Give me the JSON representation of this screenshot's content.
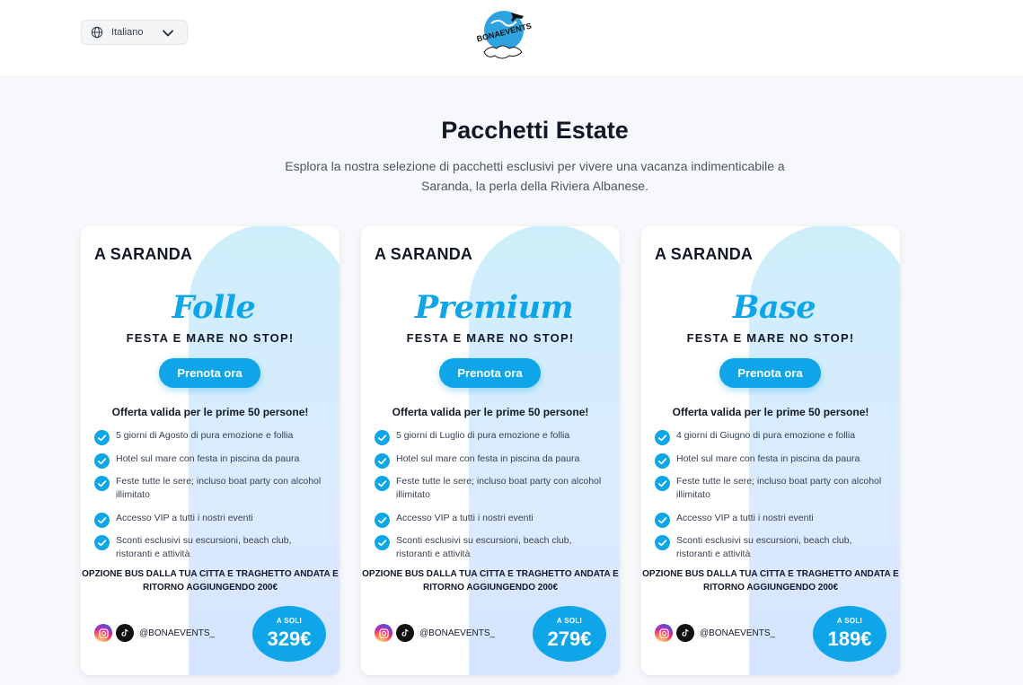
{
  "header": {
    "language_label": "Italiano",
    "logo_text": "BONAEVENTS"
  },
  "hero": {
    "title": "Pacchetti Estate",
    "subtitle": "Esplora la nostra selezione di pacchetti esclusivi per vivere una vacanza indimenticabile a Saranda, la perla della Riviera Albanese."
  },
  "colors": {
    "accent": "#0ea5e9",
    "background": "#f6f8fb",
    "card": "#ffffff"
  },
  "packages": [
    {
      "location": "A SARANDA",
      "name": "Folle",
      "tagline": "FESTA E MARE NO STOP!",
      "cta": "Prenota ora",
      "offer": "Offerta valida per le prime 50 persone!",
      "features": [
        "5 giorni di Agosto di pura emozione e follia",
        "Hotel sul mare con festa in piscina da paura",
        "Feste tutte le sere; incluso boat party con alcohol illimitato",
        "Accesso VIP a tutti i nostri eventi",
        "Sconti esclusivi su escursioni, beach club, ristoranti e attività"
      ],
      "bus_note": "OPZIONE BUS DALLA TUA CITTA E TRAGHETTO ANDATA E RITORNO AGGIUNGENDO 200€",
      "social_handle": "@BONAEVENTS_",
      "price_label": "A SOLI",
      "price": "329€"
    },
    {
      "location": "A SARANDA",
      "name": "Premium",
      "tagline": "FESTA E MARE NO STOP!",
      "cta": "Prenota ora",
      "offer": "Offerta valida per le prime 50 persone!",
      "features": [
        "5 giorni di Luglio di pura emozione e follia",
        "Hotel sul mare con festa in piscina da paura",
        "Feste tutte le sere; incluso boat party con alcohol illimitato",
        "Accesso VIP a tutti i nostri eventi",
        "Sconti esclusivi su escursioni, beach club, ristoranti e attività"
      ],
      "bus_note": "OPZIONE BUS DALLA TUA CITTA E TRAGHETTO ANDATA E RITORNO AGGIUNGENDO 200€",
      "social_handle": "@BONAEVENTS_",
      "price_label": "A SOLI",
      "price": "279€"
    },
    {
      "location": "A SARANDA",
      "name": "Base",
      "tagline": "FESTA E MARE NO STOP!",
      "cta": "Prenota ora",
      "offer": "Offerta valida per le prime 50 persone!",
      "features": [
        "4 giorni di Giugno di pura emozione e follia",
        "Hotel sul mare con festa in piscina da paura",
        "Feste tutte le sere; incluso boat party con alcohol illimitato",
        "Accesso VIP a tutti i nostri eventi",
        "Sconti esclusivi su escursioni, beach club, ristoranti e attività"
      ],
      "bus_note": "OPZIONE BUS DALLA TUA CITTA E TRAGHETTO ANDATA E RITORNO AGGIUNGENDO 200€",
      "social_handle": "@BONAEVENTS_",
      "price_label": "A SOLI",
      "price": "189€"
    }
  ]
}
